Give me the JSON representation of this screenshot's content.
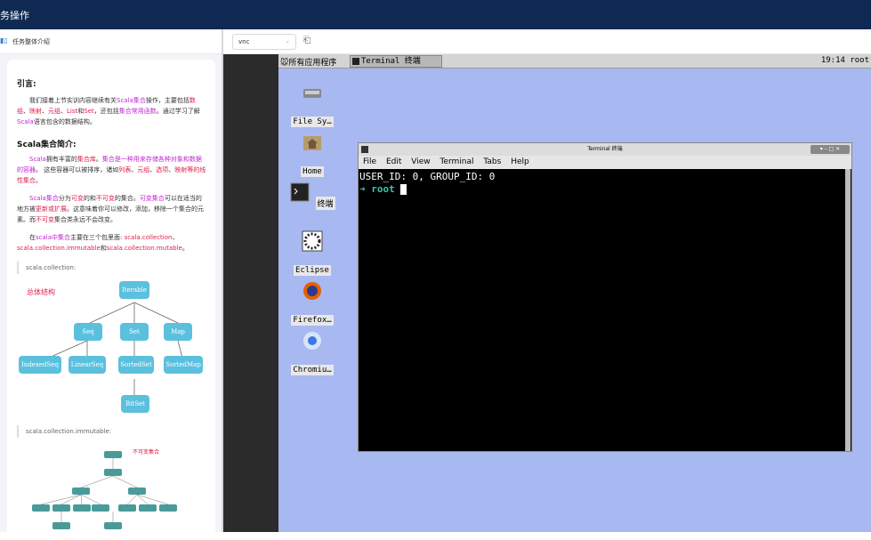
{
  "topbar": {
    "title": "务操作"
  },
  "left_header": {
    "label": "任务整体介绍"
  },
  "doc": {
    "h_intro": "引言:",
    "intro": [
      {
        "t": "我们接着上节实训内容继续有关",
        "c": ""
      },
      {
        "t": "Scala集合",
        "c": "m"
      },
      {
        "t": "操作，主要包括",
        "c": ""
      },
      {
        "t": "数组",
        "c": "r"
      },
      {
        "t": "、",
        "c": ""
      },
      {
        "t": "映射",
        "c": "r"
      },
      {
        "t": "、",
        "c": ""
      },
      {
        "t": "元组",
        "c": "r"
      },
      {
        "t": "、",
        "c": ""
      },
      {
        "t": "List",
        "c": "r"
      },
      {
        "t": "和",
        "c": ""
      },
      {
        "t": "Set",
        "c": "r"
      },
      {
        "t": "，还包括",
        "c": ""
      },
      {
        "t": "集合常用函数",
        "c": "m"
      },
      {
        "t": "。通过学习了解",
        "c": ""
      },
      {
        "t": "Scala",
        "c": "m"
      },
      {
        "t": "语言包含的数据结构。",
        "c": ""
      }
    ],
    "h_brief": "Scala集合简介:",
    "p1": [
      {
        "t": "Scala",
        "c": "m"
      },
      {
        "t": "拥有丰富的",
        "c": ""
      },
      {
        "t": "集合库",
        "c": "r"
      },
      {
        "t": "。",
        "c": ""
      },
      {
        "t": "集合是一种用来存储各种对象和数据的容器",
        "c": "m"
      },
      {
        "t": "。 这些容器可以被排序，诸如",
        "c": ""
      },
      {
        "t": "列表",
        "c": "r"
      },
      {
        "t": "、",
        "c": ""
      },
      {
        "t": "元组",
        "c": "r"
      },
      {
        "t": "、",
        "c": ""
      },
      {
        "t": "选项",
        "c": "r"
      },
      {
        "t": "、",
        "c": ""
      },
      {
        "t": "映射等的线性集合",
        "c": "r"
      },
      {
        "t": "。",
        "c": ""
      }
    ],
    "p2": [
      {
        "t": "Scala集合",
        "c": "m"
      },
      {
        "t": "分为",
        "c": ""
      },
      {
        "t": "可变",
        "c": "r"
      },
      {
        "t": "的和",
        "c": ""
      },
      {
        "t": "不可变",
        "c": "r"
      },
      {
        "t": "的集合。",
        "c": ""
      },
      {
        "t": "可变集合",
        "c": "m"
      },
      {
        "t": "可以在适当的地方被",
        "c": ""
      },
      {
        "t": "更新或扩展",
        "c": "r"
      },
      {
        "t": "。这意味着你可以修改，添加，移除一个集合的元素。而",
        "c": ""
      },
      {
        "t": "不可变",
        "c": "r"
      },
      {
        "t": "集合类永远不会改变。",
        "c": ""
      }
    ],
    "p3": [
      {
        "t": "在",
        "c": ""
      },
      {
        "t": "scala中集合",
        "c": "m"
      },
      {
        "t": "主要在三个包里面: ",
        "c": ""
      },
      {
        "t": "scala.collection",
        "c": "r"
      },
      {
        "t": "、",
        "c": ""
      },
      {
        "t": "scala.collection.immutable",
        "c": "r"
      },
      {
        "t": "和",
        "c": ""
      },
      {
        "t": "scala.collection.mutable",
        "c": "r"
      },
      {
        "t": "。",
        "c": ""
      }
    ],
    "quote1": "scala.collection:",
    "tree_label": "总体结构",
    "nodes": [
      "Iterable",
      "Seq",
      "Set",
      "Map",
      "IndexedSeq",
      "LinearSeq",
      "SortedSet",
      "SortedMap",
      "BitSet"
    ],
    "quote2": "scala.collection.immutable:",
    "mini_label": "不可变集合"
  },
  "toolbar": {
    "select_value": "vnc",
    "chevron": "⌄",
    "share_icon": "⎗"
  },
  "vnc": {
    "apps_menu": "所有应用程序",
    "taskbar_item": "Terminal 终端",
    "clock": "19:14 root",
    "desktop_icons": [
      "File Sy…",
      "Home",
      "终端",
      "Eclipse",
      "Firefox…",
      "Chromiu…"
    ],
    "terminal": {
      "title": "Terminal 终端",
      "window_buttons": "▾ – □ ✕",
      "menu": [
        "File",
        "Edit",
        "View",
        "Terminal",
        "Tabs",
        "Help"
      ],
      "line1": "USER_ID: 0, GROUP_ID: 0",
      "prompt_arrow": "➜",
      "prompt_dir": "root"
    }
  }
}
